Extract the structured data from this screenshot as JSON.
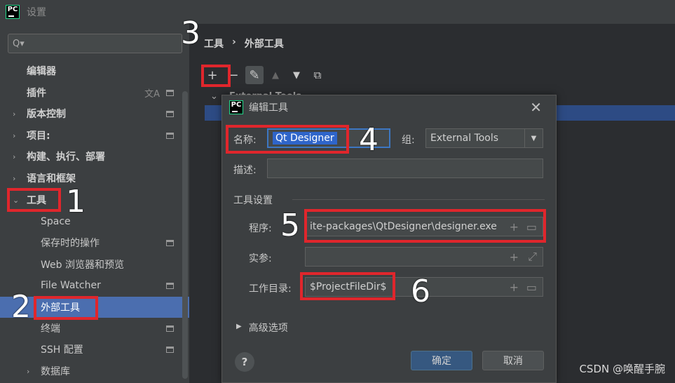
{
  "window": {
    "title": "设置"
  },
  "search": {
    "placeholder": "Q▾"
  },
  "sidebar": {
    "items": [
      {
        "label": "编辑器",
        "bold": true
      },
      {
        "label": "插件",
        "bold": true
      },
      {
        "label": "版本控制",
        "bold": true
      },
      {
        "label": "项目: ",
        "bold": true
      },
      {
        "label": "构建、执行、部署",
        "bold": true
      },
      {
        "label": "语言和框架",
        "bold": true
      },
      {
        "label": "工具",
        "bold": true
      },
      {
        "label": "Space"
      },
      {
        "label": "保存时的操作"
      },
      {
        "label": "Web 浏览器和预览"
      },
      {
        "label": "File Watcher"
      },
      {
        "label": "外部工具"
      },
      {
        "label": "终端"
      },
      {
        "label": "SSH 配置"
      },
      {
        "label": "数据库"
      }
    ]
  },
  "main": {
    "breadcrumb": [
      "工具",
      "›",
      "外部工具"
    ],
    "tree_label": "External Tools"
  },
  "dialog": {
    "title": "编辑工具",
    "name_label": "名称:",
    "name_value": "Qt Designer",
    "group_label": "组:",
    "group_value": "External Tools",
    "desc_label": "描述:",
    "section_label": "工具设置",
    "program_label": "程序:",
    "program_value": "ite-packages\\QtDesigner\\designer.exe",
    "args_label": "实参:",
    "workdir_label": "工作目录:",
    "workdir_value": "$ProjectFileDir$",
    "advanced_label": "高级选项",
    "ok_label": "确定",
    "cancel_label": "取消"
  },
  "annotations": [
    "1",
    "2",
    "3",
    "4",
    "5",
    "6"
  ],
  "watermark": "CSDN @唤醒手腕",
  "colors": {
    "highlight": "#e0262c",
    "selection": "#4b6eaf",
    "primary_button": "#365880"
  }
}
